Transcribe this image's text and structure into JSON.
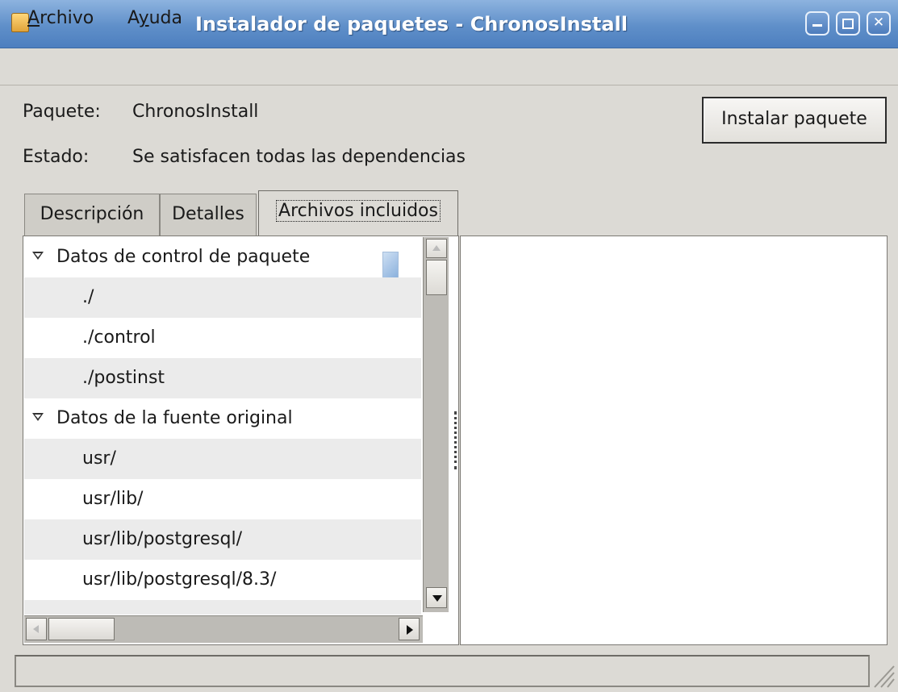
{
  "window": {
    "title": "Instalador de paquetes - ChronosInstall",
    "buttons": [
      "minimize",
      "maximize",
      "close"
    ]
  },
  "menubar": {
    "items": [
      {
        "label": "Archivo",
        "mnemonic": "A"
      },
      {
        "label": "Ayuda",
        "mnemonic": "y"
      }
    ]
  },
  "info": {
    "package_label": "Paquete:",
    "package_value": "ChronosInstall",
    "status_label": "Estado:",
    "status_value": "Se satisfacen todas las dependencias",
    "install_button": "Instalar paquete"
  },
  "tabs": [
    {
      "label": "Descripción",
      "active": false
    },
    {
      "label": "Detalles",
      "active": false
    },
    {
      "label": "Archivos incluidos",
      "active": true
    }
  ],
  "tree": {
    "rows": [
      {
        "label": "Datos de control de paquete",
        "group": true
      },
      {
        "label": "./",
        "group": false
      },
      {
        "label": "./control",
        "group": false
      },
      {
        "label": "./postinst",
        "group": false
      },
      {
        "label": "Datos de la fuente original",
        "group": true
      },
      {
        "label": "usr/",
        "group": false
      },
      {
        "label": "usr/lib/",
        "group": false
      },
      {
        "label": "usr/lib/postgresql/",
        "group": false
      },
      {
        "label": "usr/lib/postgresql/8.3/",
        "group": false
      }
    ]
  },
  "statusbar": {
    "text": ""
  },
  "colors": {
    "titlebar": "#5f8fc9",
    "window_bg": "#dcdad5",
    "row_alt": "#ebebeb"
  }
}
